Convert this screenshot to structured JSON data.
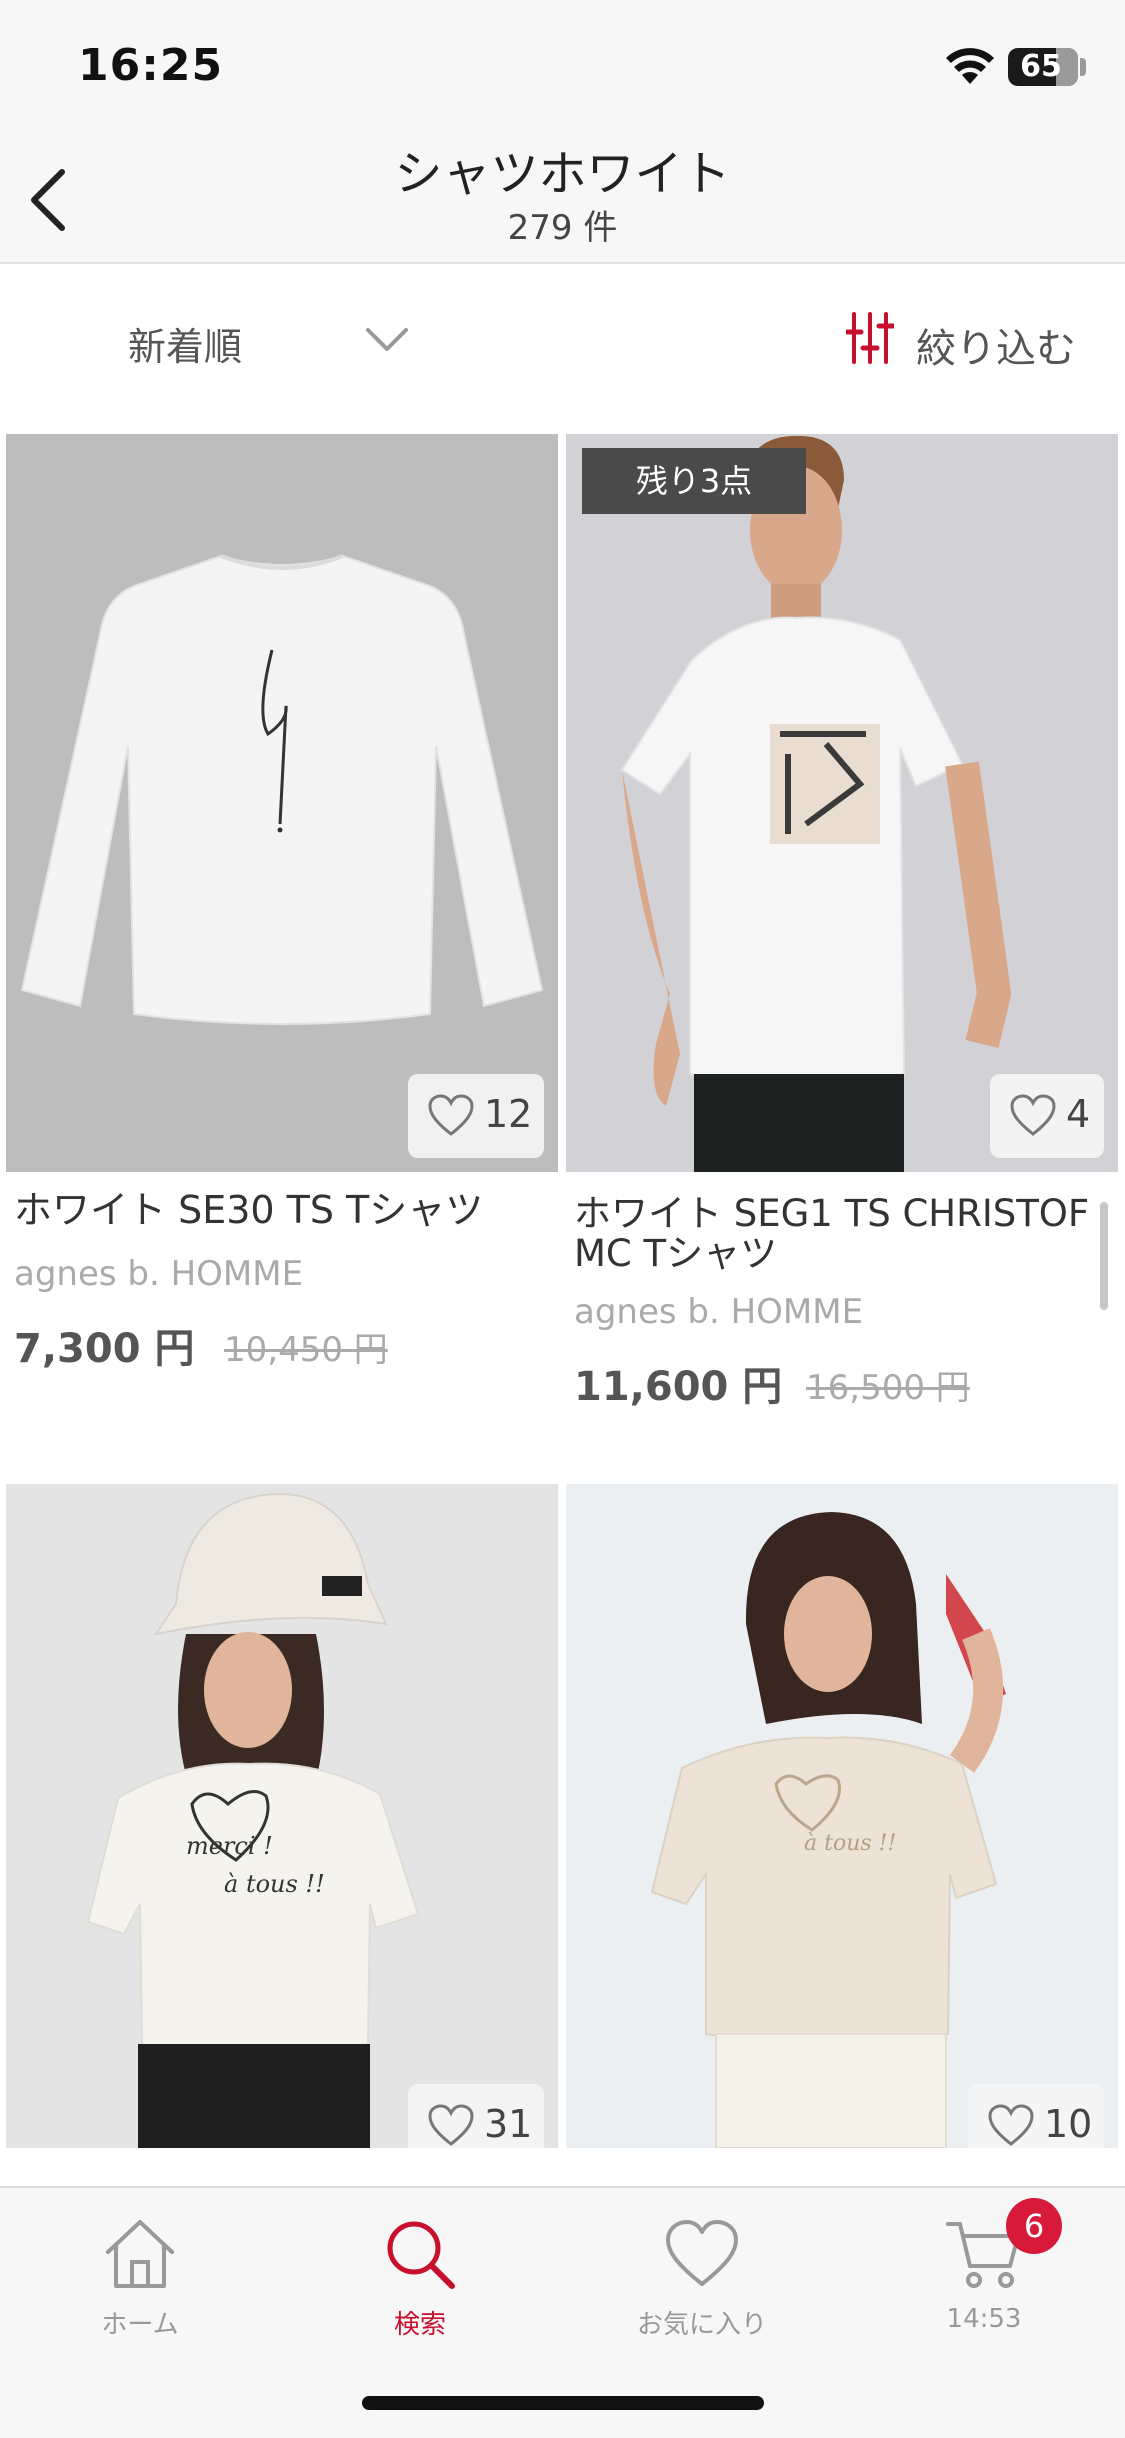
{
  "status": {
    "time": "16:25",
    "battery": "65"
  },
  "nav": {
    "title": "シャツホワイト",
    "count": "279 件"
  },
  "toolbar": {
    "sort_label": "新着順",
    "filter_label": "絞り込む"
  },
  "products": [
    {
      "name": "ホワイト SE30 TS Tシャツ",
      "brand": "agnes b. HOMME",
      "price": "7,300 円",
      "original_price": "10,450 円",
      "likes": "12",
      "badge": ""
    },
    {
      "name": "ホワイト SEG1 TS CHRISTOF MC Tシャツ",
      "brand": "agnes b. HOMME",
      "price": "11,600 円",
      "original_price": "16,500 円",
      "likes": "4",
      "badge": "残り3点"
    },
    {
      "name": "",
      "brand": "",
      "price": "",
      "original_price": "",
      "likes": "31",
      "badge": ""
    },
    {
      "name": "",
      "brand": "",
      "price": "",
      "original_price": "",
      "likes": "10",
      "badge": ""
    }
  ],
  "tabs": [
    {
      "label": "ホーム",
      "icon": "home-icon"
    },
    {
      "label": "検索",
      "icon": "search-icon"
    },
    {
      "label": "お気に入り",
      "icon": "heart-icon"
    },
    {
      "label": "14:53",
      "icon": "cart-icon"
    }
  ],
  "cart_badge": "6",
  "colors": {
    "accent": "#c8102e",
    "badge_red": "#d7193a",
    "badge_grey": "#4a4a4a",
    "background": "#f7f7f7"
  }
}
